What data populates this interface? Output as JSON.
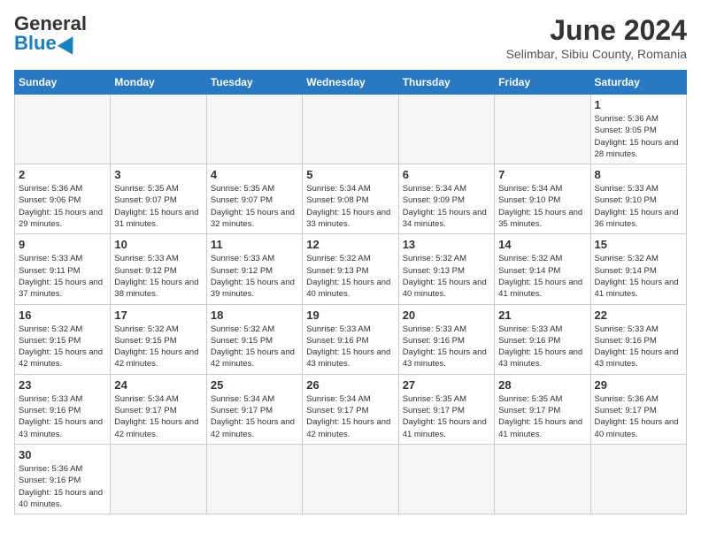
{
  "header": {
    "logo_general": "General",
    "logo_blue": "Blue",
    "title": "June 2024",
    "subtitle": "Selimbar, Sibiu County, Romania"
  },
  "days_of_week": [
    "Sunday",
    "Monday",
    "Tuesday",
    "Wednesday",
    "Thursday",
    "Friday",
    "Saturday"
  ],
  "weeks": [
    [
      {
        "day": "",
        "info": ""
      },
      {
        "day": "",
        "info": ""
      },
      {
        "day": "",
        "info": ""
      },
      {
        "day": "",
        "info": ""
      },
      {
        "day": "",
        "info": ""
      },
      {
        "day": "",
        "info": ""
      },
      {
        "day": "1",
        "info": "Sunrise: 5:36 AM\nSunset: 9:05 PM\nDaylight: 15 hours and 28 minutes."
      }
    ],
    [
      {
        "day": "2",
        "info": "Sunrise: 5:36 AM\nSunset: 9:06 PM\nDaylight: 15 hours and 29 minutes."
      },
      {
        "day": "3",
        "info": "Sunrise: 5:35 AM\nSunset: 9:07 PM\nDaylight: 15 hours and 31 minutes."
      },
      {
        "day": "4",
        "info": "Sunrise: 5:35 AM\nSunset: 9:07 PM\nDaylight: 15 hours and 32 minutes."
      },
      {
        "day": "5",
        "info": "Sunrise: 5:34 AM\nSunset: 9:08 PM\nDaylight: 15 hours and 33 minutes."
      },
      {
        "day": "6",
        "info": "Sunrise: 5:34 AM\nSunset: 9:09 PM\nDaylight: 15 hours and 34 minutes."
      },
      {
        "day": "7",
        "info": "Sunrise: 5:34 AM\nSunset: 9:10 PM\nDaylight: 15 hours and 35 minutes."
      },
      {
        "day": "8",
        "info": "Sunrise: 5:33 AM\nSunset: 9:10 PM\nDaylight: 15 hours and 36 minutes."
      }
    ],
    [
      {
        "day": "9",
        "info": "Sunrise: 5:33 AM\nSunset: 9:11 PM\nDaylight: 15 hours and 37 minutes."
      },
      {
        "day": "10",
        "info": "Sunrise: 5:33 AM\nSunset: 9:12 PM\nDaylight: 15 hours and 38 minutes."
      },
      {
        "day": "11",
        "info": "Sunrise: 5:33 AM\nSunset: 9:12 PM\nDaylight: 15 hours and 39 minutes."
      },
      {
        "day": "12",
        "info": "Sunrise: 5:32 AM\nSunset: 9:13 PM\nDaylight: 15 hours and 40 minutes."
      },
      {
        "day": "13",
        "info": "Sunrise: 5:32 AM\nSunset: 9:13 PM\nDaylight: 15 hours and 40 minutes."
      },
      {
        "day": "14",
        "info": "Sunrise: 5:32 AM\nSunset: 9:14 PM\nDaylight: 15 hours and 41 minutes."
      },
      {
        "day": "15",
        "info": "Sunrise: 5:32 AM\nSunset: 9:14 PM\nDaylight: 15 hours and 41 minutes."
      }
    ],
    [
      {
        "day": "16",
        "info": "Sunrise: 5:32 AM\nSunset: 9:15 PM\nDaylight: 15 hours and 42 minutes."
      },
      {
        "day": "17",
        "info": "Sunrise: 5:32 AM\nSunset: 9:15 PM\nDaylight: 15 hours and 42 minutes."
      },
      {
        "day": "18",
        "info": "Sunrise: 5:32 AM\nSunset: 9:15 PM\nDaylight: 15 hours and 42 minutes."
      },
      {
        "day": "19",
        "info": "Sunrise: 5:33 AM\nSunset: 9:16 PM\nDaylight: 15 hours and 43 minutes."
      },
      {
        "day": "20",
        "info": "Sunrise: 5:33 AM\nSunset: 9:16 PM\nDaylight: 15 hours and 43 minutes."
      },
      {
        "day": "21",
        "info": "Sunrise: 5:33 AM\nSunset: 9:16 PM\nDaylight: 15 hours and 43 minutes."
      },
      {
        "day": "22",
        "info": "Sunrise: 5:33 AM\nSunset: 9:16 PM\nDaylight: 15 hours and 43 minutes."
      }
    ],
    [
      {
        "day": "23",
        "info": "Sunrise: 5:33 AM\nSunset: 9:16 PM\nDaylight: 15 hours and 43 minutes."
      },
      {
        "day": "24",
        "info": "Sunrise: 5:34 AM\nSunset: 9:17 PM\nDaylight: 15 hours and 42 minutes."
      },
      {
        "day": "25",
        "info": "Sunrise: 5:34 AM\nSunset: 9:17 PM\nDaylight: 15 hours and 42 minutes."
      },
      {
        "day": "26",
        "info": "Sunrise: 5:34 AM\nSunset: 9:17 PM\nDaylight: 15 hours and 42 minutes."
      },
      {
        "day": "27",
        "info": "Sunrise: 5:35 AM\nSunset: 9:17 PM\nDaylight: 15 hours and 41 minutes."
      },
      {
        "day": "28",
        "info": "Sunrise: 5:35 AM\nSunset: 9:17 PM\nDaylight: 15 hours and 41 minutes."
      },
      {
        "day": "29",
        "info": "Sunrise: 5:36 AM\nSunset: 9:17 PM\nDaylight: 15 hours and 40 minutes."
      }
    ],
    [
      {
        "day": "30",
        "info": "Sunrise: 5:36 AM\nSunset: 9:16 PM\nDaylight: 15 hours and 40 minutes."
      },
      {
        "day": "",
        "info": ""
      },
      {
        "day": "",
        "info": ""
      },
      {
        "day": "",
        "info": ""
      },
      {
        "day": "",
        "info": ""
      },
      {
        "day": "",
        "info": ""
      },
      {
        "day": "",
        "info": ""
      }
    ]
  ]
}
